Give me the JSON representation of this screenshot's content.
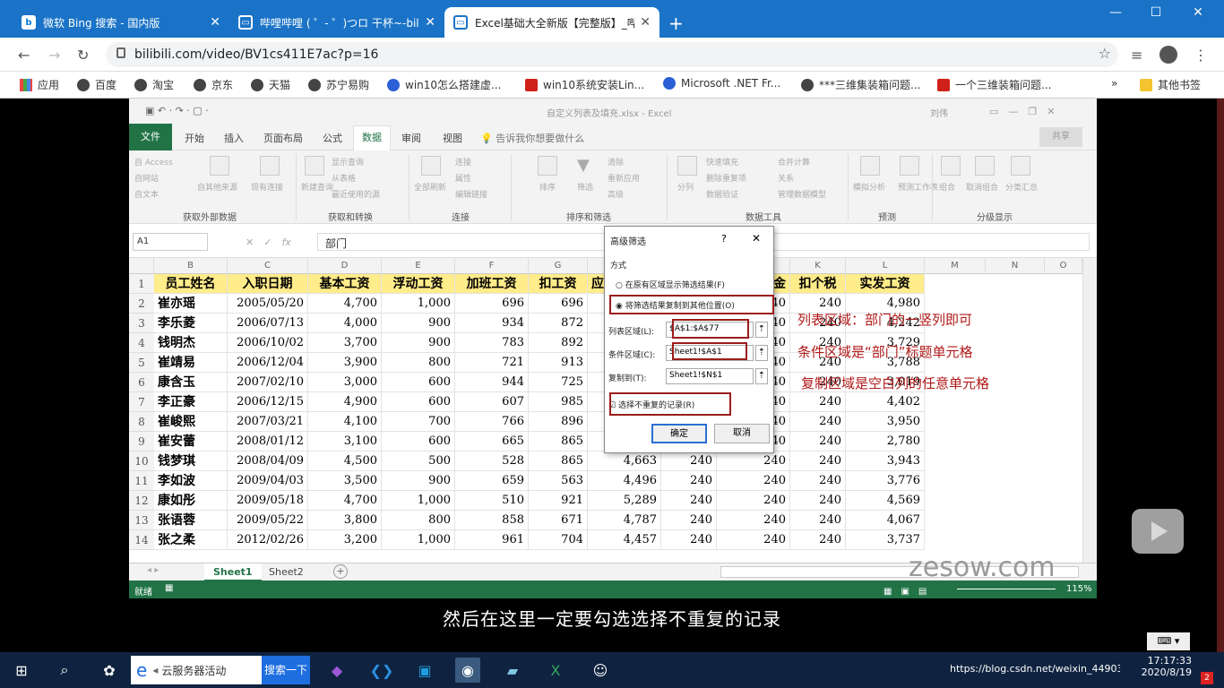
{
  "browser": {
    "tabs": [
      {
        "title": "微软 Bing 搜索 - 国内版",
        "icon": "bing-icon"
      },
      {
        "title": "哔哩哔哩 ( ゜- ゜)つロ 干杯~-bili",
        "icon": "bilibili-icon"
      },
      {
        "title": "Excel基础大全新版【完整版】_哔",
        "icon": "bilibili-icon"
      }
    ],
    "url": "bilibili.com/video/BV1cs411E7ac?p=16",
    "bookmarks": [
      "应用",
      "百度",
      "淘宝",
      "京东",
      "天猫",
      "苏宁易购",
      "win10怎么搭建虚...",
      "win10系统安装Lin...",
      "Microsoft .NET Fr...",
      "***三维集装箱问题...",
      "一个三维装箱问题..."
    ],
    "other_bookmarks": "其他书签",
    "more": "»"
  },
  "excel": {
    "title": "自定义列表及填充.xlsx - Excel",
    "user": "刘伟",
    "menu": [
      "文件",
      "开始",
      "插入",
      "页面布局",
      "公式",
      "数据",
      "审阅",
      "视图",
      "告诉我你想要做什么"
    ],
    "share": "共享",
    "ribbon": {
      "groups": [
        "获取外部数据",
        "获取和转换",
        "连接",
        "排序和筛选",
        "数据工具",
        "预测",
        "分级显示"
      ],
      "buttons": [
        "自 Access",
        "自网站",
        "自文本",
        "自其他来源",
        "现有连接",
        "新建查询",
        "显示查询",
        "从表格",
        "最近使用的源",
        "全部刷新",
        "连接",
        "属性",
        "编辑链接",
        "排序",
        "筛选",
        "清除",
        "重新应用",
        "高级",
        "分列",
        "快速填充",
        "删除重复项",
        "数据验证",
        "合并计算",
        "关系",
        "管理数据模型",
        "模拟分析",
        "预测工作表",
        "组合",
        "取消组合",
        "分类汇总"
      ]
    },
    "namebox": "A1",
    "formula": "部门",
    "columns": [
      "B",
      "C",
      "D",
      "E",
      "F",
      "G",
      "",
      "",
      "",
      "K",
      "L",
      "M",
      "N",
      "O"
    ],
    "headers": [
      "员工姓名",
      "入职日期",
      "基本工资",
      "浮动工资",
      "加班工资",
      "扣工资",
      "应",
      "",
      "金",
      "扣个税",
      "实发工资"
    ],
    "rows": [
      [
        "2",
        "崔亦瑶",
        "2005/05/20",
        "4,700",
        "1,000",
        "696",
        "696",
        "",
        "",
        "240",
        "240",
        "4,980"
      ],
      [
        "3",
        "李乐菱",
        "2006/07/13",
        "4,000",
        "900",
        "934",
        "872",
        "",
        "",
        "240",
        "240",
        "4,242"
      ],
      [
        "4",
        "钱明杰",
        "2006/10/02",
        "3,700",
        "900",
        "783",
        "892",
        "",
        "",
        "240",
        "240",
        "3,729"
      ],
      [
        "5",
        "崔靖易",
        "2006/12/04",
        "3,900",
        "800",
        "721",
        "913",
        "",
        "",
        "240",
        "240",
        "3,788"
      ],
      [
        "6",
        "康含玉",
        "2007/02/10",
        "3,000",
        "600",
        "944",
        "725",
        "",
        "",
        "240",
        "240",
        "3,019"
      ],
      [
        "7",
        "李正豪",
        "2006/12/15",
        "4,900",
        "600",
        "607",
        "985",
        "",
        "",
        "240",
        "240",
        "4,402"
      ],
      [
        "8",
        "崔峻熙",
        "2007/03/21",
        "4,100",
        "700",
        "766",
        "896",
        "",
        "",
        "240",
        "240",
        "3,950"
      ],
      [
        "9",
        "崔安蕾",
        "2008/01/12",
        "3,100",
        "600",
        "665",
        "865",
        "",
        "",
        "240",
        "240",
        "2,780"
      ],
      [
        "10",
        "钱梦琪",
        "2008/04/09",
        "4,500",
        "500",
        "528",
        "865",
        "4,663",
        "240",
        "240",
        "240",
        "3,943"
      ],
      [
        "11",
        "李如波",
        "2009/04/03",
        "3,500",
        "900",
        "659",
        "563",
        "4,496",
        "240",
        "240",
        "240",
        "3,776"
      ],
      [
        "12",
        "康如彤",
        "2009/05/18",
        "4,700",
        "1,000",
        "510",
        "921",
        "5,289",
        "240",
        "240",
        "240",
        "4,569"
      ],
      [
        "13",
        "张语蓉",
        "2009/05/22",
        "3,800",
        "800",
        "858",
        "671",
        "4,787",
        "240",
        "240",
        "240",
        "4,067"
      ],
      [
        "14",
        "张之柔",
        "2012/02/26",
        "3,200",
        "1,000",
        "961",
        "704",
        "4,457",
        "240",
        "240",
        "240",
        "3,737"
      ]
    ],
    "sheets": [
      "Sheet1",
      "Sheet2"
    ],
    "status": "就绪",
    "zoom": "115%"
  },
  "dialog": {
    "title": "高级筛选",
    "help": "?",
    "close": "✕",
    "mode_label": "方式",
    "opt1": "在原有区域显示筛选结果(F)",
    "opt2": "将筛选结果复制到其他位置(O)",
    "list_label": "列表区域(L):",
    "list_value": "$A$1:$A$77",
    "crit_label": "条件区域(C):",
    "crit_value": "Sheet1!$A$1",
    "copy_label": "复制到(T):",
    "copy_value": "Sheet1!$N$1",
    "unique": "选择不重复的记录(R)",
    "ok": "确定",
    "cancel": "取消"
  },
  "annotations": [
    "列表区域：部门的一竖列即可",
    "条件区域是“部门”标题单元格",
    "复制区域是空白列的任意单元格"
  ],
  "subtitle": "然后在这里一定要勾选选择不重复的记录",
  "watermark": "zesow.com",
  "taskbar": {
    "search_text": "云服务器活动",
    "search_button": "搜索一下",
    "tray_text": "https://blog.csdn.net/weixin_449035",
    "time": "17:17:33",
    "date": "2020/8/19",
    "badge": "2"
  },
  "colors": {
    "accent": "#217346",
    "chrome_tab": "#1a73c7",
    "taskbar": "#0f2340",
    "annotation": "#b01818",
    "header_fill": "#ffec8a"
  }
}
